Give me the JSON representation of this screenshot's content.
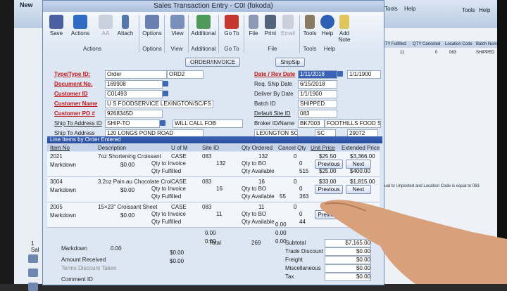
{
  "background": {
    "new_label": "New",
    "right_tools": [
      "Tools",
      "Help",
      "Tools",
      "Help"
    ],
    "right_columns": [
      "QTY Fulfilled",
      "QTY Canceled",
      "Location Code",
      "Batch Number"
    ],
    "right_row": [
      "11",
      "0",
      "083",
      "SHIPPED"
    ],
    "right_note": "ual to Unposted and Location Code is equal to 083",
    "left_item": "1 Sal"
  },
  "window": {
    "title": "Sales Transaction Entry  -  C0I (fokoda)"
  },
  "ribbon": {
    "buttons": [
      "Save",
      "Actions",
      "AA",
      "Attach",
      "Options",
      "View",
      "Additional",
      "Go To",
      "File",
      "Print",
      "Email",
      "Tools",
      "Help",
      "Add Note"
    ],
    "groups": [
      "Actions",
      "Options",
      "View",
      "Additional",
      "Go To",
      "File",
      "Tools",
      "Help"
    ]
  },
  "form": {
    "order_invoice_btn": "ORDER/INVOICE",
    "shipsip_btn": "ShipSip",
    "type_label": "Type/Type ID:",
    "type_value": "Order",
    "type_id_value": "ORD2",
    "doc_label": "Document No.",
    "doc_value": "169908",
    "customer_id_label": "Customer ID",
    "customer_id_value": "C01493",
    "customer_name_label": "Customer Name",
    "customer_name_value": "U S FOODSERVICE LEXINGTON/SC/FS",
    "customer_po_label": "Customer PO #",
    "customer_po_value": "9268345D",
    "ship_addr_label": "Ship To Address ID",
    "ship_addr_value": "SHIP-TO",
    "ship_method_value": "WILL CALL FOB",
    "ship_to_label": "Ship To Address",
    "ship_to_value": "120 LONGS POND ROAD",
    "date_label": "Date / Rev Date",
    "date_value": "1/11/2018",
    "rev_date_value": "1/1/1900",
    "req_ship_label": "Req. Ship Date",
    "req_ship_value": "6/15/2018",
    "deliver_label": "Deliver By Date",
    "deliver_value": "1/1/1900",
    "batch_label": "Batch ID",
    "batch_value": "SHIPPED",
    "site_label": "Default Site ID",
    "site_value": "083",
    "broker_label": "Broker ID/Name",
    "broker_id": "BK7003",
    "broker_name": "FOOTHILLS FOOD SERVI",
    "city_value": "LEXINGTON SC",
    "state_value": "SC",
    "zip_value": "29072"
  },
  "grid": {
    "title": "Line Items by Order Entered",
    "headers": [
      "Item No",
      "Description",
      "U of M",
      "Site ID",
      "Qty Ordered",
      "Cancel Qty",
      "Unit Price",
      "Extended Price"
    ],
    "labels": {
      "markdown": "Markdown",
      "qty_invoice": "Qty to Invoice",
      "qty_fulfilled": "Qty Fulfilled",
      "qty_bo": "Qty to BO",
      "qty_available": "Qty Available"
    },
    "rows": [
      {
        "item": "2021",
        "desc": "7oz Shortening Croissant",
        "uom": "CASE",
        "site": "083",
        "qty": "132",
        "cancel": "0",
        "price": "$25.50",
        "ext": "$3,366.00",
        "markdown": "$0.00",
        "inv": "132",
        "bo": "0",
        "avail": "515",
        "mdprice": "$25.00",
        "mdext": "$400.00"
      },
      {
        "item": "3004",
        "desc": "3.2oz Pain au Chocolate Croi",
        "uom": "CASE",
        "site": "083",
        "qty": "16",
        "cancel": "0",
        "price": "$33.00",
        "ext": "$1,815.00",
        "markdown": "$0.00",
        "inv": "16",
        "bo": "0",
        "avail": "363",
        "mdprice": "",
        "mdext": ""
      },
      {
        "item": "2005",
        "desc": "15×23\" Croissant Sheet",
        "uom": "CASE",
        "site": "083",
        "qty": "11",
        "cancel": "0",
        "price": "",
        "ext": "",
        "markdown": "$0.00",
        "inv": "11",
        "bo": "0",
        "avail": "44",
        "mdprice": "",
        "mdext": ""
      }
    ],
    "nav": {
      "previous": "Previous",
      "next": "Next"
    },
    "extra_numbers": [
      "55",
      "0.00",
      "0.00",
      "0.00",
      "0.00",
      "0.00"
    ]
  },
  "totals": {
    "amount_received_label": "Amount Received",
    "amount_received": "$0.00",
    "terms_label": "Terms Discount Taken",
    "terms_value": "$0.00",
    "comment_label": "Comment ID",
    "total_label": "Total",
    "total_qty": "269",
    "subtotal_label": "Subtotal",
    "subtotal": "$7,165.00",
    "trade_label": "Trade Discount",
    "trade": "$0.00",
    "freight_label": "Freight",
    "freight": "$0.00",
    "misc_label": "Miscellaneous",
    "misc": "$0.00",
    "tax_label": "Tax",
    "tax": "$0.00",
    "markdown_label": "Markdown",
    "markdown_total": "0.00"
  },
  "colors": {
    "accent": "#284d9d",
    "required": "#c01818"
  }
}
